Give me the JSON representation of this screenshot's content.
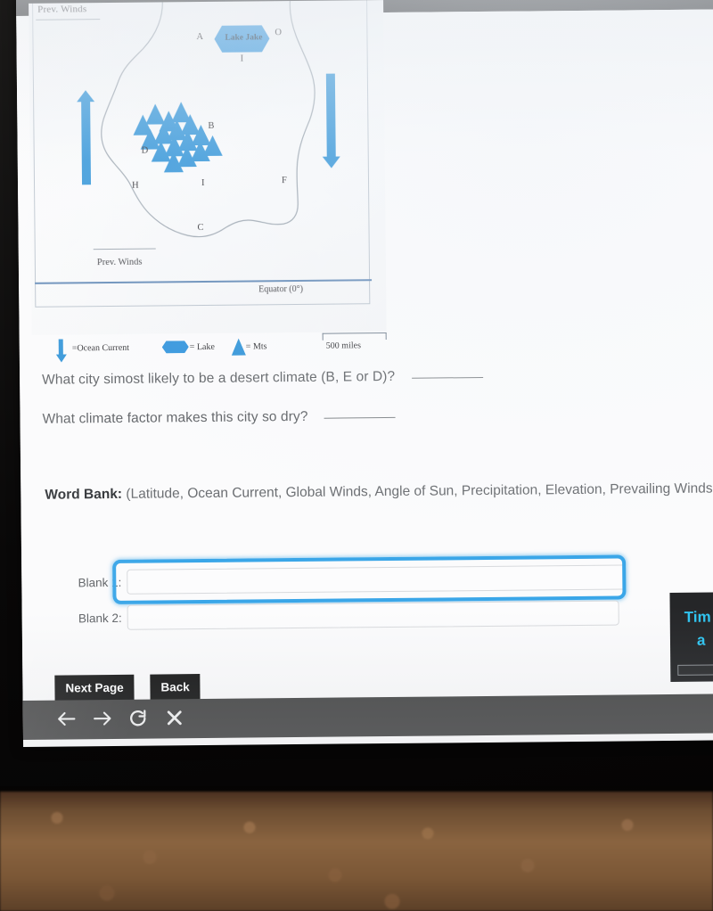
{
  "window": {
    "page_background": "#fbfbfc",
    "topbar_color": "#17181a"
  },
  "map": {
    "title_top_label": "Prev. Winds",
    "title_bottom_label": "Prev. Winds",
    "equator_label": "Equator (0°)",
    "lake_label": "Lake Jake",
    "region_labels": [
      "A",
      "O",
      "I",
      "B",
      "D",
      "H",
      "I",
      "F",
      "C"
    ],
    "legend": {
      "ocean_current": "=Ocean Current",
      "lake": "= Lake",
      "mountains": "= Mts",
      "scale": "500 miles"
    },
    "accent_color": "#2f93d8",
    "equator_color": "#5f87b5"
  },
  "questions": [
    {
      "text": "What city simost likely to be a desert climate (B, E or D)?"
    },
    {
      "text": "What climate factor makes this city so dry?"
    }
  ],
  "word_bank": {
    "label": "Word Bank:",
    "text": "(Latitude, Ocean Current, Global Winds, Angle of Sun, Precipitation, Elevation, Prevailing Winds, Altitude)"
  },
  "blanks": [
    {
      "label": "Blank 1:",
      "value": "",
      "placeholder": "",
      "focused": true
    },
    {
      "label": "Blank 2:",
      "value": "",
      "placeholder": "",
      "focused": false
    }
  ],
  "buttons": {
    "next_page": "Next Page",
    "back": "Back"
  },
  "timer": {
    "line1": "Tim",
    "line2": "a",
    "accent_color": "#2fc4f0",
    "panel_color": "#252628"
  },
  "toolbar": {
    "background": "#4b4b4b",
    "icons": [
      "back-arrow",
      "forward-arrow",
      "reload",
      "close"
    ]
  }
}
